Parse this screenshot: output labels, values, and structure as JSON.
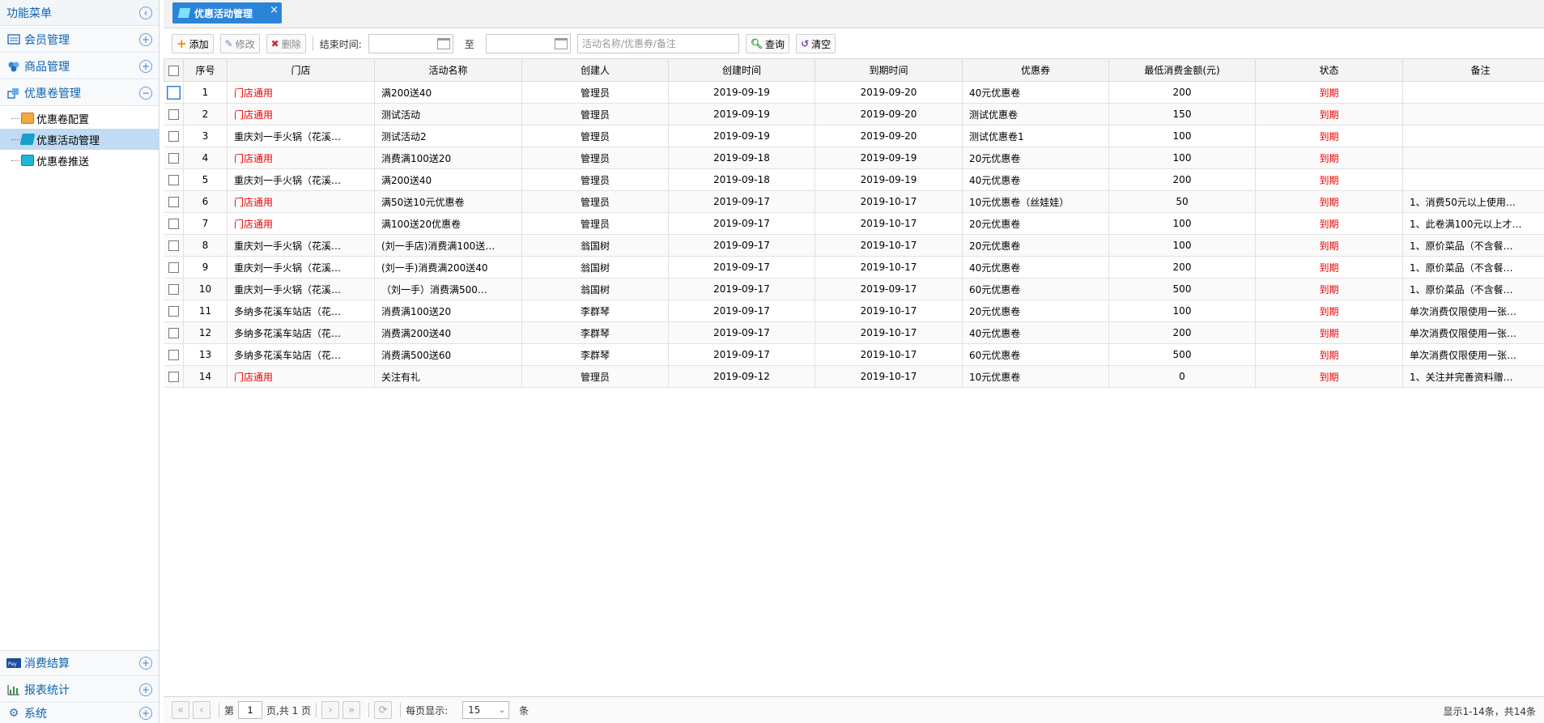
{
  "sidebar": {
    "title": "功能菜单",
    "sections": [
      {
        "label": "会员管理",
        "toggle": "+"
      },
      {
        "label": "商品管理",
        "toggle": "+"
      },
      {
        "label": "优惠卷管理",
        "toggle": "−"
      },
      {
        "label": "消费结算",
        "toggle": "+"
      },
      {
        "label": "报表统计",
        "toggle": "+"
      },
      {
        "label": "系统",
        "toggle": "+"
      }
    ],
    "tree": [
      {
        "label": "优惠卷配置"
      },
      {
        "label": "优惠活动管理"
      },
      {
        "label": "优惠卷推送"
      }
    ]
  },
  "tab": {
    "label": "优惠活动管理",
    "close": "×"
  },
  "toolbar": {
    "add": "添加",
    "edit": "修改",
    "delete": "删除",
    "end_time_label": "结束时间:",
    "to_label": "至",
    "search_placeholder": "活动名称/优惠券/备注",
    "query": "查询",
    "clear": "清空"
  },
  "grid": {
    "columns": [
      "序号",
      "门店",
      "活动名称",
      "创建人",
      "创建时间",
      "到期时间",
      "优惠券",
      "最低消费金额(元)",
      "状态",
      "备注"
    ],
    "rows": [
      [
        "1",
        "门店通用",
        "满200送40",
        "管理员",
        "2019-09-19",
        "2019-09-20",
        "40元优惠卷",
        "200",
        "到期",
        ""
      ],
      [
        "2",
        "门店通用",
        "测试活动",
        "管理员",
        "2019-09-19",
        "2019-09-20",
        "测试优惠卷",
        "150",
        "到期",
        ""
      ],
      [
        "3",
        "重庆刘一手火锅（花溪…",
        "测试活动2",
        "管理员",
        "2019-09-19",
        "2019-09-20",
        "测试优惠卷1",
        "100",
        "到期",
        ""
      ],
      [
        "4",
        "门店通用",
        "消费满100送20",
        "管理员",
        "2019-09-18",
        "2019-09-19",
        "20元优惠卷",
        "100",
        "到期",
        ""
      ],
      [
        "5",
        "重庆刘一手火锅（花溪…",
        "满200送40",
        "管理员",
        "2019-09-18",
        "2019-09-19",
        "40元优惠卷",
        "200",
        "到期",
        ""
      ],
      [
        "6",
        "门店通用",
        "满50送10元优惠卷",
        "管理员",
        "2019-09-17",
        "2019-10-17",
        "10元优惠卷（丝娃娃）",
        "50",
        "到期",
        "1、消费50元以上使用…"
      ],
      [
        "7",
        "门店通用",
        "满100送20优惠卷",
        "管理员",
        "2019-09-17",
        "2019-10-17",
        "20元优惠卷",
        "100",
        "到期",
        "1、此卷满100元以上才…"
      ],
      [
        "8",
        "重庆刘一手火锅（花溪…",
        "(刘一手店)消费满100送…",
        "翁国树",
        "2019-09-17",
        "2019-10-17",
        "20元优惠卷",
        "100",
        "到期",
        "1、原价菜品（不含餐…"
      ],
      [
        "9",
        "重庆刘一手火锅（花溪…",
        "(刘一手)消费满200送40",
        "翁国树",
        "2019-09-17",
        "2019-10-17",
        "40元优惠卷",
        "200",
        "到期",
        "1、原价菜品（不含餐…"
      ],
      [
        "10",
        "重庆刘一手火锅（花溪…",
        "（刘一手）消费满500…",
        "翁国树",
        "2019-09-17",
        "2019-09-17",
        "60元优惠卷",
        "500",
        "到期",
        "1、原价菜品（不含餐…"
      ],
      [
        "11",
        "多纳多花溪车站店（花…",
        "消费满100送20",
        "李群琴",
        "2019-09-17",
        "2019-10-17",
        "20元优惠卷",
        "100",
        "到期",
        "单次消费仅限使用一张…"
      ],
      [
        "12",
        "多纳多花溪车站店（花…",
        "消费满200送40",
        "李群琴",
        "2019-09-17",
        "2019-10-17",
        "40元优惠卷",
        "200",
        "到期",
        "单次消费仅限使用一张…"
      ],
      [
        "13",
        "多纳多花溪车站店（花…",
        "消费满500送60",
        "李群琴",
        "2019-09-17",
        "2019-10-17",
        "60元优惠卷",
        "500",
        "到期",
        "单次消费仅限使用一张…"
      ],
      [
        "14",
        "门店通用",
        "关注有礼",
        "管理员",
        "2019-09-12",
        "2019-10-17",
        "10元优惠卷",
        "0",
        "到期",
        "1、关注并完善资料赠…"
      ]
    ]
  },
  "pager": {
    "page_prefix": "第",
    "page_value": "1",
    "page_suffix": "页,共 1 页",
    "per_page_label": "每页显示:",
    "per_page_value": "15",
    "per_page_unit": "条",
    "info": "显示1-14条，共14条"
  },
  "colors": {
    "accent": "#2c84d8",
    "red": "#e00000",
    "selected": "#c0dbf3"
  }
}
